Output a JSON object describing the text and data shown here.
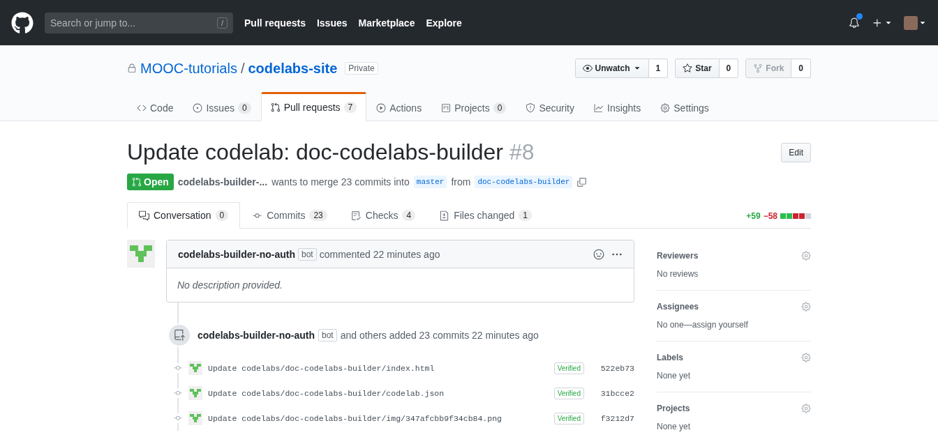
{
  "header": {
    "search": {
      "placeholder": "Search or jump to...",
      "shortcut": "/"
    },
    "nav": [
      "Pull requests",
      "Issues",
      "Marketplace",
      "Explore"
    ],
    "notifications_unread": true
  },
  "repo": {
    "owner": "MOOC-tutorials",
    "separator": "/",
    "name": "codelabs-site",
    "visibility": "Private",
    "actions": [
      {
        "kind": "watch",
        "label": "Unwatch",
        "count": "1",
        "disabled": false
      },
      {
        "kind": "star",
        "label": "Star",
        "count": "0",
        "disabled": false
      },
      {
        "kind": "fork",
        "label": "Fork",
        "count": "0",
        "disabled": true
      }
    ]
  },
  "repo_tabs": [
    {
      "label": "Code",
      "selected": false
    },
    {
      "label": "Issues",
      "count": "0",
      "selected": false
    },
    {
      "label": "Pull requests",
      "count": "7",
      "selected": true
    },
    {
      "label": "Actions",
      "selected": false
    },
    {
      "label": "Projects",
      "count": "0",
      "selected": false
    },
    {
      "label": "Security",
      "selected": false
    },
    {
      "label": "Insights",
      "selected": false
    },
    {
      "label": "Settings",
      "selected": false
    }
  ],
  "pull_request": {
    "title": "Update codelab: doc-codelabs-builder",
    "number": "#8",
    "edit_button": "Edit",
    "state": "Open",
    "author": "codelabs-builder-...",
    "summary": "wants to merge 23 commits into",
    "base": "master",
    "from": "from",
    "head": "doc-codelabs-builder"
  },
  "pr_tabs": [
    {
      "label": "Conversation",
      "count": "0",
      "selected": true
    },
    {
      "label": "Commits",
      "count": "23",
      "selected": false
    },
    {
      "label": "Checks",
      "count": "4",
      "selected": false
    },
    {
      "label": "Files changed",
      "count": "1",
      "selected": false
    }
  ],
  "diffstat": {
    "additions": "+59",
    "deletions": "−58",
    "blocks": [
      {
        "color": "#2cbe4e"
      },
      {
        "color": "#2cbe4e"
      },
      {
        "color": "#cb2431"
      },
      {
        "color": "#cb2431"
      },
      {
        "color": "#d1d5da"
      }
    ]
  },
  "comment": {
    "author": "codelabs-builder-no-auth",
    "badge": "bot",
    "action": "commented 22 minutes ago",
    "body": "No description provided."
  },
  "commit_group": {
    "author": "codelabs-builder-no-auth",
    "badge": "bot",
    "text": "and others added 23 commits 22 minutes ago",
    "commits": [
      {
        "message": "Update codelabs/doc-codelabs-builder/index.html",
        "verified": "Verified",
        "sha": "522eb73"
      },
      {
        "message": "Update codelabs/doc-codelabs-builder/codelab.json",
        "verified": "Verified",
        "sha": "31bcce2"
      },
      {
        "message": "Update codelabs/doc-codelabs-builder/img/347afcbb9f34cb84.png",
        "verified": "Verified",
        "sha": "f3212d7"
      }
    ]
  },
  "sidebar": [
    {
      "heading": "Reviewers",
      "value": "No reviews"
    },
    {
      "heading": "Assignees",
      "value": "No one—assign yourself"
    },
    {
      "heading": "Labels",
      "value": "None yet"
    },
    {
      "heading": "Projects",
      "value": "None yet"
    }
  ]
}
